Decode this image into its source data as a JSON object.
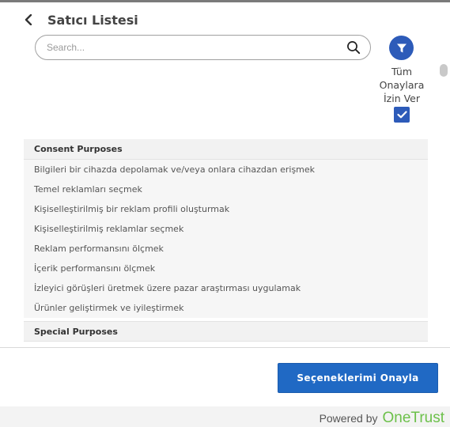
{
  "header": {
    "title": "Satıcı Listesi"
  },
  "search": {
    "placeholder": "Search..."
  },
  "allow_all": {
    "line1": "Tüm",
    "line2": "Onaylara",
    "line3": "İzin Ver",
    "checked": true
  },
  "sections": [
    {
      "title": "Consent Purposes",
      "items": [
        "Bilgileri bir cihazda depolamak ve/veya onlara cihazdan erişmek",
        "Temel reklamları seçmek",
        "Kişiselleştirilmiş bir reklam profili oluşturmak",
        "Kişiselleştirilmiş reklamlar seçmek",
        "Reklam performansını ölçmek",
        "İçerik performansını ölçmek",
        "İzleyici görüşleri üretmek üzere pazar araştırması uygulamak",
        "Ürünler geliştirmek ve iyileştirmek"
      ]
    },
    {
      "title": "Special Purposes"
    }
  ],
  "actions": {
    "confirm_label": "Seçeneklerimi Onayla"
  },
  "footer": {
    "powered_by": "Powered by",
    "brand": "OneTrust"
  },
  "colors": {
    "accent": "#2d5bb9",
    "button": "#2069c4",
    "brand": "#6cc04a"
  }
}
